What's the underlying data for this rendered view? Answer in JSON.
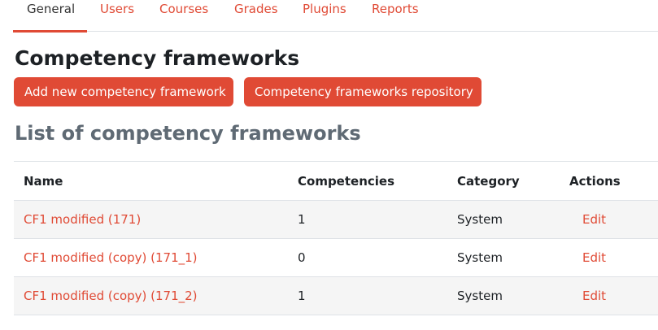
{
  "tabs": [
    {
      "label": "General",
      "active": true
    },
    {
      "label": "Users"
    },
    {
      "label": "Courses"
    },
    {
      "label": "Grades"
    },
    {
      "label": "Plugins"
    },
    {
      "label": "Reports"
    }
  ],
  "page_title": "Competency frameworks",
  "buttons": {
    "add": "Add new competency framework",
    "repository": "Competency frameworks repository"
  },
  "list_title": "List of competency frameworks",
  "table": {
    "headers": [
      "Name",
      "Competencies",
      "Category",
      "Actions"
    ],
    "rows": [
      {
        "name": "CF1 modified (171)",
        "competencies": "1",
        "category": "System",
        "action": "Edit"
      },
      {
        "name": "CF1 modified (copy) (171_1)",
        "competencies": "0",
        "category": "System",
        "action": "Edit"
      },
      {
        "name": "CF1 modified (copy) (171_2)",
        "competencies": "1",
        "category": "System",
        "action": "Edit"
      }
    ]
  },
  "colors": {
    "accent": "#e04a35",
    "row_stripe": "#f5f5f5",
    "subheading": "#5f6a74"
  }
}
